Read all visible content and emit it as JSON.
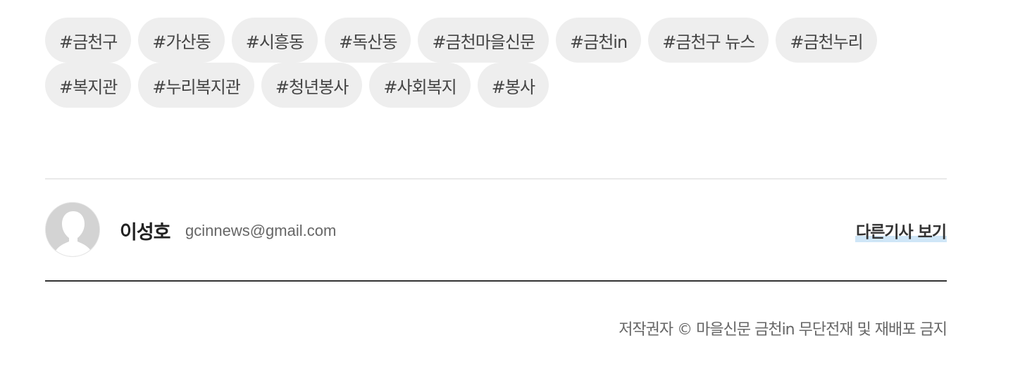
{
  "tags": [
    "#금천구",
    "#가산동",
    "#시흥동",
    "#독산동",
    "#금천마을신문",
    "#금천in",
    "#금천구 뉴스",
    "#금천누리",
    "#복지관",
    "#누리복지관",
    "#청년봉사",
    "#사회복지",
    "#봉사"
  ],
  "author": {
    "avatar_icon": "person-avatar-icon",
    "name": "이성호",
    "email": "gcinnews@gmail.com",
    "more_articles_label": "다른기사 보기"
  },
  "footer": {
    "copyright": "저작권자 © 마을신문 금천in 무단전재 및 재배포 금지"
  },
  "colors": {
    "tag_background": "#eeeeee",
    "highlight": "#cfe6f7",
    "divider_strong": "#333333",
    "divider_light": "#e9e9e9"
  }
}
